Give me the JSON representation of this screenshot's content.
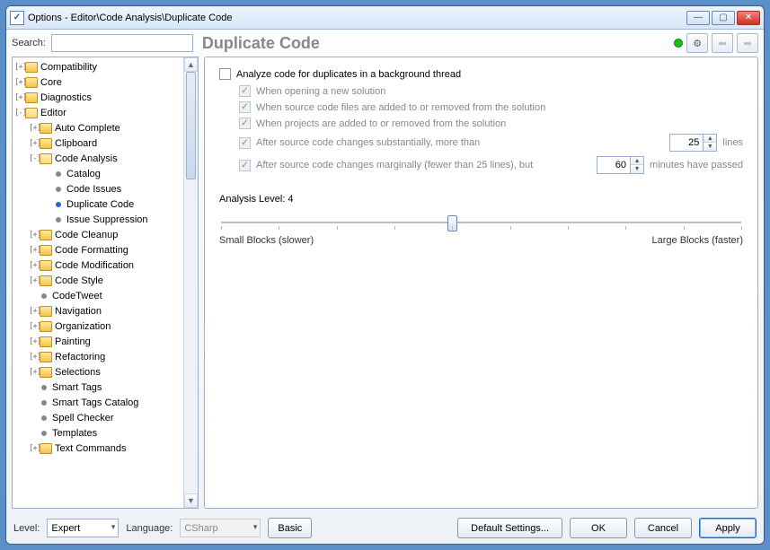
{
  "window": {
    "title": "Options - Editor\\Code Analysis\\Duplicate Code"
  },
  "search": {
    "label": "Search:",
    "value": ""
  },
  "page": {
    "title": "Duplicate Code"
  },
  "tree": {
    "items": [
      {
        "d": 0,
        "tw": "+",
        "icon": "folder",
        "label": "Compatibility"
      },
      {
        "d": 0,
        "tw": "+",
        "icon": "folder",
        "label": "Core"
      },
      {
        "d": 0,
        "tw": "+",
        "icon": "folder",
        "label": "Diagnostics"
      },
      {
        "d": 0,
        "tw": "-",
        "icon": "folder-open",
        "label": "Editor"
      },
      {
        "d": 1,
        "tw": "+",
        "icon": "folder",
        "label": "Auto Complete"
      },
      {
        "d": 1,
        "tw": "+",
        "icon": "folder",
        "label": "Clipboard"
      },
      {
        "d": 1,
        "tw": "-",
        "icon": "folder-open",
        "label": "Code Analysis"
      },
      {
        "d": 2,
        "tw": "",
        "icon": "leaf",
        "label": "Catalog"
      },
      {
        "d": 2,
        "tw": "",
        "icon": "leaf",
        "label": "Code Issues"
      },
      {
        "d": 2,
        "tw": "",
        "icon": "leaf-selected",
        "label": "Duplicate Code"
      },
      {
        "d": 2,
        "tw": "",
        "icon": "leaf",
        "label": "Issue Suppression"
      },
      {
        "d": 1,
        "tw": "+",
        "icon": "folder",
        "label": "Code Cleanup"
      },
      {
        "d": 1,
        "tw": "+",
        "icon": "folder",
        "label": "Code Formatting"
      },
      {
        "d": 1,
        "tw": "+",
        "icon": "folder",
        "label": "Code Modification"
      },
      {
        "d": 1,
        "tw": "+",
        "icon": "folder",
        "label": "Code Style"
      },
      {
        "d": 1,
        "tw": "",
        "icon": "leaf",
        "label": "CodeTweet"
      },
      {
        "d": 1,
        "tw": "+",
        "icon": "folder",
        "label": "Navigation"
      },
      {
        "d": 1,
        "tw": "+",
        "icon": "folder",
        "label": "Organization"
      },
      {
        "d": 1,
        "tw": "+",
        "icon": "folder",
        "label": "Painting"
      },
      {
        "d": 1,
        "tw": "+",
        "icon": "folder",
        "label": "Refactoring"
      },
      {
        "d": 1,
        "tw": "+",
        "icon": "folder",
        "label": "Selections"
      },
      {
        "d": 1,
        "tw": "",
        "icon": "leaf",
        "label": "Smart Tags"
      },
      {
        "d": 1,
        "tw": "",
        "icon": "leaf",
        "label": "Smart Tags Catalog"
      },
      {
        "d": 1,
        "tw": "",
        "icon": "leaf",
        "label": "Spell Checker"
      },
      {
        "d": 1,
        "tw": "",
        "icon": "leaf",
        "label": "Templates"
      },
      {
        "d": 1,
        "tw": "+",
        "icon": "folder",
        "label": "Text Commands"
      }
    ]
  },
  "options": {
    "analyze_bg": {
      "label": "Analyze code for duplicates in a background thread",
      "checked": false
    },
    "when_open": {
      "label": "When opening a new solution",
      "checked": true
    },
    "when_files": {
      "label": "When source code files are added to or removed from the solution",
      "checked": true
    },
    "when_projects": {
      "label": "When projects are added to or removed from the solution",
      "checked": true
    },
    "after_substantial": {
      "label": "After source code changes substantially, more than",
      "checked": true,
      "value": "25",
      "unit": "lines"
    },
    "after_marginal": {
      "label": "After source code changes marginally (fewer than 25 lines), but",
      "checked": true,
      "value": "60",
      "unit": "minutes have passed"
    }
  },
  "slider": {
    "title": "Analysis Level: 4",
    "left": "Small Blocks (slower)",
    "right": "Large Blocks (faster)",
    "value": 4,
    "min": 0,
    "max": 9
  },
  "bottom": {
    "level_label": "Level:",
    "level_value": "Expert",
    "language_label": "Language:",
    "language_value": "CSharp",
    "basic": "Basic",
    "defaults": "Default Settings...",
    "ok": "OK",
    "cancel": "Cancel",
    "apply": "Apply"
  }
}
